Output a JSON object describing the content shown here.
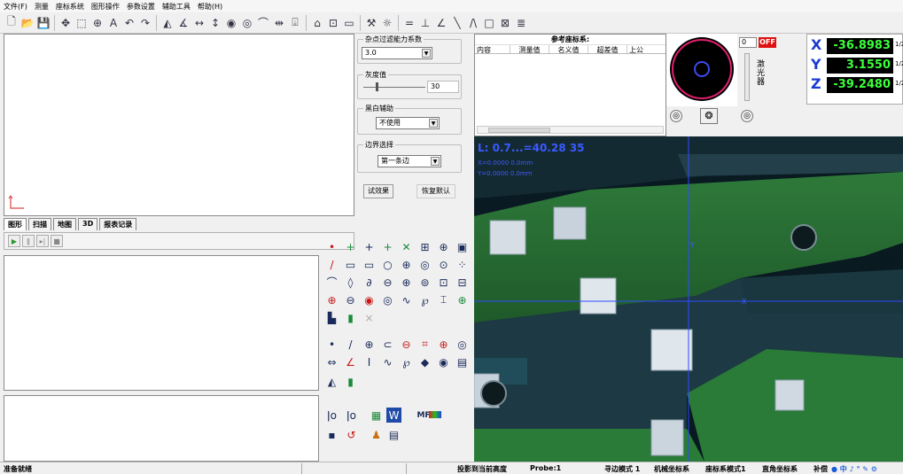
{
  "menu": [
    "文件(F)",
    "测量",
    "座标系统",
    "图形操作",
    "参数设置",
    "辅助工具",
    "帮助(H)"
  ],
  "toolbar": {
    "icons": [
      "new-file-icon",
      "open-folder-icon",
      "save-icon",
      "move-icon",
      "zoom-window-icon",
      "zoom-fit-icon",
      "text-icon",
      "undo-icon",
      "redo-icon",
      "triangle-icon",
      "angle-icon",
      "horizontal-distance-icon",
      "vertical-distance-icon",
      "circle-icon",
      "circle-alt-icon",
      "arc-dim-icon",
      "x-distance-icon",
      "y-distance-icon",
      "home-icon",
      "rect-select-icon",
      "rect-icon",
      "tools-icon",
      "sun-icon",
      "equal-icon",
      "perpendicular-icon",
      "angle-line-icon",
      "diagonal-icon",
      "parallel-icon",
      "square-icon",
      "box-icon",
      "list-icon"
    ],
    "glyphs": [
      "🗋",
      "📂",
      "💾",
      "✥",
      "⬚",
      "⊕",
      "A",
      "↶",
      "↷",
      "◭",
      "∡",
      "↔",
      "↕",
      "◉",
      "◎",
      "⌒",
      "⇹",
      "⍗",
      "⌂",
      "⊡",
      "▭",
      "⚒",
      "☼",
      "=",
      "⊥",
      "∠",
      "╲",
      "/\\",
      "□",
      "⊠",
      "≣"
    ]
  },
  "filter": {
    "noise_label": "杂点过滤能力系数",
    "noise_value": "3.0",
    "gray_label": "灰度值",
    "gray_value": "30",
    "bw_label": "黑白辅助",
    "bw_value": "不使用",
    "edge_label": "边界选择",
    "edge_value": "第一条边",
    "try_button": "试效果",
    "reset_button": "恢复默认"
  },
  "tabs": [
    "图形",
    "扫描",
    "地图",
    "3D",
    "报表记录"
  ],
  "reference": {
    "title": "参考座标系:",
    "columns": [
      "内容",
      "测量值",
      "名义值",
      "超差值",
      "上公"
    ]
  },
  "light": {
    "intensity": "0",
    "off_label": "OFF",
    "laser_label": "激光器"
  },
  "dro": {
    "rows": [
      {
        "axis": "X",
        "value": "-36.8983",
        "unit": "1/2"
      },
      {
        "axis": "Y",
        "value": "3.1550",
        "unit": "1/2"
      },
      {
        "axis": "Z",
        "value": "-39.2480",
        "unit": "1/2"
      }
    ]
  },
  "camera": {
    "line1": "L: 0.7...=40.28 35",
    "line2": "X=0.0000 0.0mm",
    "line3": "Y=0.0000 0.0mm",
    "crosshair_color": "#2f4bff",
    "y_label": "Y",
    "x_label": "X"
  },
  "palette": {
    "row1": [
      "point-icon",
      "cross-icon",
      "gray-cross-icon",
      "auto-point-icon",
      "intersect-icon",
      "box-measure-icon",
      "zoom-icon",
      "image-icon"
    ],
    "row2": [
      "line-icon",
      "rect-slot-icon",
      "rect-slot2-icon",
      "circle-tool-icon",
      "circle-cross-icon",
      "circle-3pt-icon",
      "circle-dot-icon",
      "dots-icon"
    ],
    "row3": [
      "arc-icon",
      "spiral-icon",
      "curve-icon",
      "ellipse-icon",
      "ring-icon",
      "ring2-icon",
      "frame-icon",
      "frame2-icon"
    ],
    "row4": [
      "ring-cross-icon",
      "ring-lines-icon",
      "gear-icon",
      "double-circle-icon",
      "zigzag-icon",
      "blob-icon",
      "i-beam-icon",
      "plus-circle-icon"
    ],
    "row5": [
      "stamp-icon",
      "green-block-icon",
      "x-disabled-icon"
    ],
    "row6": [
      "dot-small-icon",
      "slash-icon",
      "circle-plus-icon",
      "circle-c-icon",
      "ellipse-red-icon",
      "red-bracket-icon",
      "red-ring-icon",
      "double-ring-icon"
    ],
    "row7": [
      "arrows-icon",
      "angle-tool-icon",
      "i-tool-icon",
      "wave-icon",
      "blob2-icon",
      "diamond-icon",
      "target-icon",
      "cylinder-icon"
    ],
    "row8": [
      "cone-icon",
      "green-bar-icon"
    ],
    "glyph1": [
      "•",
      "+",
      "+",
      "+",
      "✕",
      "⊞",
      "⊕",
      "▣"
    ],
    "glyph2": [
      "/",
      "▭",
      "▭",
      "○",
      "⊕",
      "◎",
      "⊙",
      "⁘"
    ],
    "glyph3": [
      "⌒",
      "◊",
      "∂",
      "⊖",
      "⊕",
      "⊚",
      "⊡",
      "⊟"
    ],
    "glyph4": [
      "⊕",
      "⊖",
      "◉",
      "◎",
      "∿",
      "℘",
      "⌶",
      "⊕"
    ],
    "glyph5": [
      "▙",
      "▮",
      "×"
    ],
    "glyph6": [
      "•",
      "/",
      "⊕",
      "⊂",
      "⊖",
      "⌗",
      "⊕",
      "◎"
    ],
    "glyph7": [
      "⇔",
      "∠",
      "I",
      "∿",
      "℘",
      "◆",
      "◉",
      "▤"
    ],
    "glyph8": [
      "◭",
      "▮"
    ],
    "extra_labels": [
      "MF"
    ]
  },
  "status": {
    "ready": "准备就绪",
    "project": "投影到当前高度",
    "probe": "Probe:1",
    "edge_mode": "寻边模式 1",
    "machine_coord": "机械坐标系",
    "coord_mode": "座标系模式1",
    "rect_coord": "直角坐标系",
    "comp": "补偿"
  }
}
